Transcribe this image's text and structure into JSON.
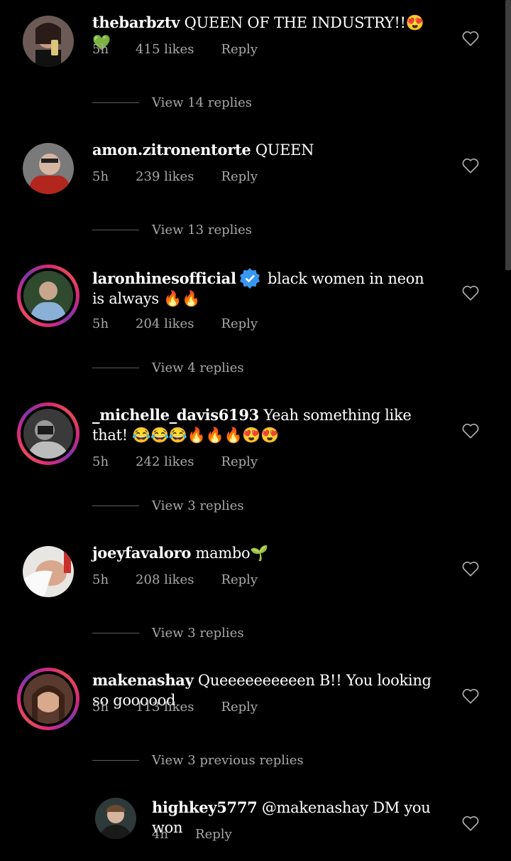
{
  "comments": [
    {
      "username": "thebarbztv",
      "text": "QUEEN OF THE INDUSTRY!!😍💚",
      "time": "5h",
      "likes": "415 likes",
      "reply": "Reply",
      "view": "View 14 replies"
    },
    {
      "username": "amon.zitronentorte",
      "text": "QUEEN",
      "time": "5h",
      "likes": "239 likes",
      "reply": "Reply",
      "view": "View 13 replies"
    },
    {
      "username": "laronhinesofficial",
      "text": "black women in neon is always 🔥🔥",
      "time": "5h",
      "likes": "204 likes",
      "reply": "Reply",
      "view": "View 4 replies"
    },
    {
      "username": "_michelle_davis6193",
      "text": "Yeah something like that! 😂😂😂🔥🔥🔥😍😍",
      "time": "5h",
      "likes": "242 likes",
      "reply": "Reply",
      "view": "View 3 replies"
    },
    {
      "username": "joeyfavaloro",
      "text": "mambo🌱",
      "time": "5h",
      "likes": "208 likes",
      "reply": "Reply",
      "view": "View 3 replies"
    },
    {
      "username": "makenashay",
      "text": "Queeeeeeeeeen B!! You looking so goooood",
      "time": "5h",
      "likes": "113 likes",
      "reply": "Reply",
      "view": "View 3 previous replies"
    }
  ],
  "reply": {
    "username": "highkey5777",
    "text": "@makenashay DM you won",
    "time": "4h",
    "reply": "Reply"
  },
  "colors": {
    "background": "#000000",
    "text": "#ffffff",
    "muted": "#a8a8a8",
    "verified": "#3897f0"
  }
}
